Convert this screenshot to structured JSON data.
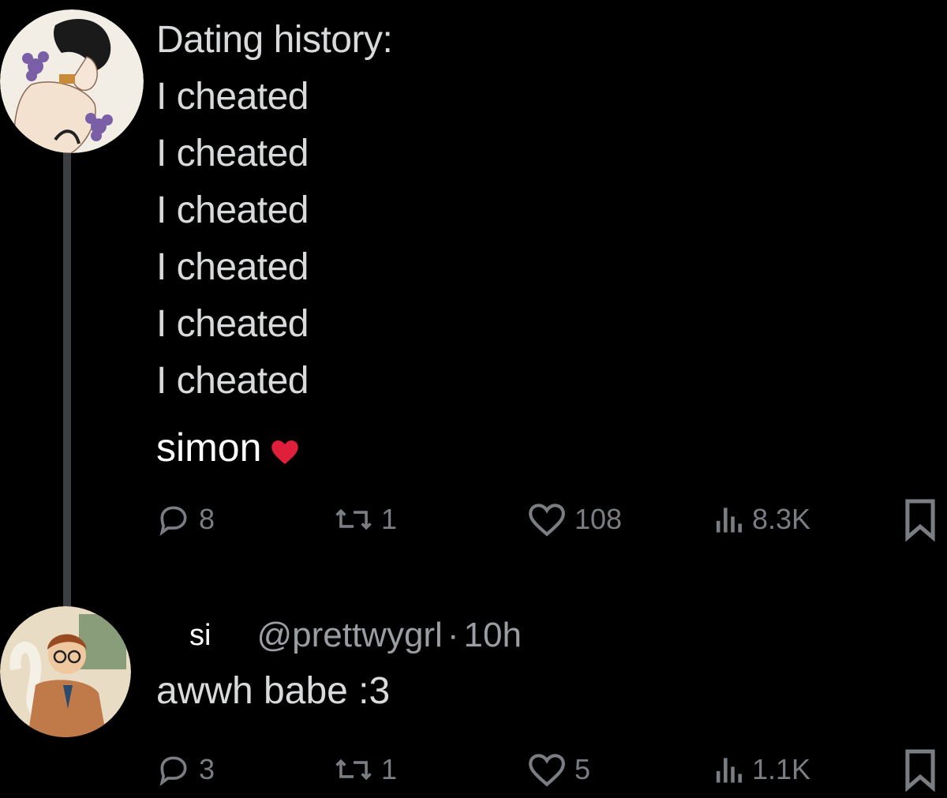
{
  "tweet": {
    "lines": [
      "Dating history:",
      "I cheated",
      "I cheated",
      "I cheated",
      "I cheated",
      "I cheated",
      "I cheated"
    ],
    "signature": "simon",
    "signature_emoji": "heart-emoji",
    "stats": {
      "replies": "8",
      "retweets": "1",
      "likes": "108",
      "views": "8.3K"
    }
  },
  "reply": {
    "display_name": "si",
    "handle": "@prettwygrl",
    "separator": "·",
    "time": "10h",
    "text": "awwh babe :3",
    "stats": {
      "replies": "3",
      "retweets": "1",
      "likes": "5",
      "views": "1.1K"
    }
  },
  "colors": {
    "background": "#000000",
    "text": "#d9dadb",
    "muted": "#7a7d82",
    "heart": "#e0203a"
  },
  "icons": [
    "reply-icon",
    "retweet-icon",
    "like-icon",
    "views-icon",
    "bookmark-icon"
  ]
}
